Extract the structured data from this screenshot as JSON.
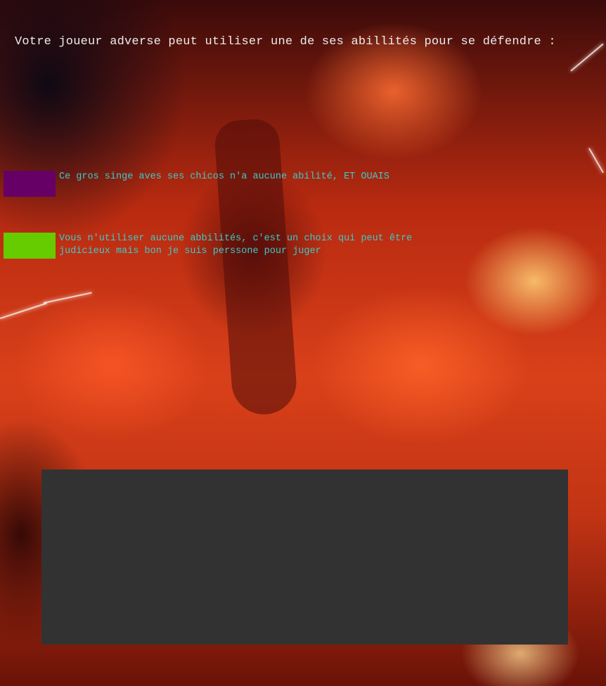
{
  "header": {
    "prompt": "Votre joueur adverse peut utiliser une de ses abillités pour se défendre :"
  },
  "options": [
    {
      "text": "Ce gros singe aves ses chicos n'a aucune abilité, ET OUAIS",
      "color": "#660066"
    },
    {
      "text": "Vous n'utiliser aucune abbilités, c'est un choix qui peut être judicieux mais bon je suis perssone pour juger",
      "color": "#66cc00"
    }
  ],
  "colors": {
    "option_text": "#3ec9c9",
    "panel": "#323232",
    "header_text": "#ececec"
  }
}
